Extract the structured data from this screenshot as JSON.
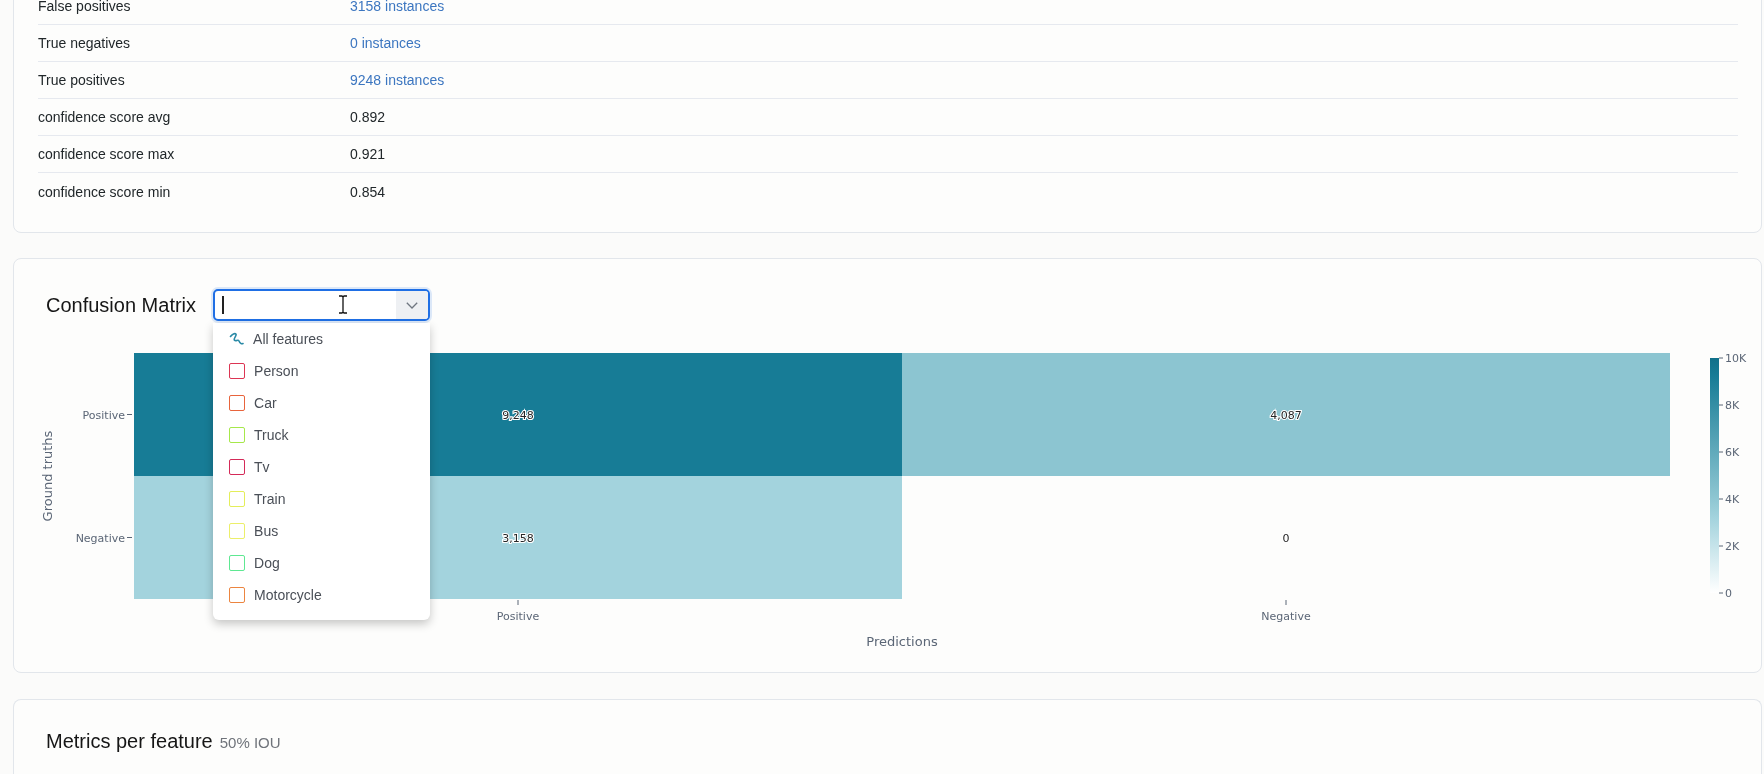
{
  "summary_table": {
    "rows": [
      {
        "label": "False positives",
        "value": "3158 instances",
        "kind": "link"
      },
      {
        "label": "True negatives",
        "value": "0 instances",
        "kind": "link"
      },
      {
        "label": "True positives",
        "value": "9248 instances",
        "kind": "link"
      },
      {
        "label": "confidence score avg",
        "value": "0.892",
        "kind": "text"
      },
      {
        "label": "confidence score max",
        "value": "0.921",
        "kind": "text"
      },
      {
        "label": "confidence score min",
        "value": "0.854",
        "kind": "text"
      }
    ]
  },
  "confusion_matrix": {
    "title": "Confusion Matrix",
    "feature_select": {
      "focused": true,
      "expanded": true,
      "options": [
        {
          "kind": "all",
          "label": "All features"
        },
        {
          "kind": "feature",
          "label": "Person",
          "color": "#dc3553",
          "checked": false
        },
        {
          "kind": "feature",
          "label": "Car",
          "color": "#e8643c",
          "checked": false
        },
        {
          "kind": "feature",
          "label": "Truck",
          "color": "#a6e84a",
          "checked": false
        },
        {
          "kind": "feature",
          "label": "Tv",
          "color": "#d42a58",
          "checked": false
        },
        {
          "kind": "feature",
          "label": "Train",
          "color": "#e4ee5a",
          "checked": false
        },
        {
          "kind": "feature",
          "label": "Bus",
          "color": "#ecef6a",
          "checked": false
        },
        {
          "kind": "feature",
          "label": "Dog",
          "color": "#5ee892",
          "checked": false
        },
        {
          "kind": "feature",
          "label": "Motorcycle",
          "color": "#ec8540",
          "checked": false
        }
      ]
    },
    "heatmap": {
      "y_axis": {
        "title": "Ground truths"
      },
      "rows": [
        {
          "label": "Positive",
          "cells": [
            {
              "value": "9,248",
              "color": "#177c96"
            },
            {
              "value": "4,087",
              "color": "#8cc5d1"
            }
          ]
        },
        {
          "label": "Negative",
          "cells": [
            {
              "value": "3,158",
              "color": "#a3d3dd"
            },
            {
              "value": "0"
            }
          ]
        }
      ],
      "x_axis": {
        "labels": [
          "Positive",
          "Negative"
        ],
        "title": "Predictions"
      },
      "colorbar": {
        "ticks": [
          "10K",
          "8K",
          "6K",
          "4K",
          "2K",
          "0"
        ]
      }
    }
  },
  "metrics_per_feature": {
    "title": "Metrics per feature",
    "subtitle": "50% IOU"
  }
}
